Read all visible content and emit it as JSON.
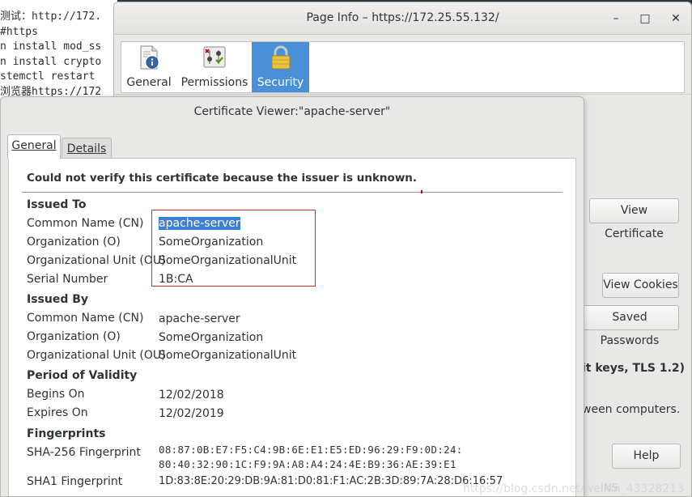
{
  "terminal": {
    "lines": [
      "测试：http://172.",
      "#https",
      "n install mod_ss",
      "n install crypto",
      "stemctl restart",
      "浏览器https://172"
    ]
  },
  "page_info": {
    "title": "Page Info – https://172.25.55.132/",
    "window_controls": {
      "minimize": "–",
      "maximize": "□",
      "close": "✕"
    },
    "tabs": [
      {
        "label": "General",
        "icon": "page-info-icon"
      },
      {
        "label": "Permissions",
        "icon": "permissions-icon"
      },
      {
        "label": "Security",
        "icon": "lock-icon",
        "selected": true
      }
    ],
    "view_certificate_label": "View Certificate",
    "view_cookies_label": "View Cookies",
    "saved_passwords_label": "Saved Passwords",
    "tls_text": "it keys, TLS 1.2)",
    "computers_text": "ween computers.",
    "help_label": "Help",
    "ins_label": "INS",
    "accent_color": "#4a90d9"
  },
  "cert_viewer": {
    "title": "Certificate Viewer:\"apache-server\"",
    "tabs": {
      "general": "General",
      "details": "Details"
    },
    "warning": "Could not verify this certificate because the issuer is unknown.",
    "issued_to": {
      "heading": "Issued To",
      "cn_label": "Common Name (CN)",
      "cn": "apache-server",
      "o_label": "Organization (O)",
      "o": "SomeOrganization",
      "ou_label": "Organizational Unit (OU)",
      "ou": "SomeOrganizationalUnit",
      "serial_label": "Serial Number",
      "serial": "1B:CA"
    },
    "issued_by": {
      "heading": "Issued By",
      "cn_label": "Common Name (CN)",
      "cn": "apache-server",
      "o_label": "Organization (O)",
      "o": "SomeOrganization",
      "ou_label": "Organizational Unit (OU)",
      "ou": "SomeOrganizationalUnit"
    },
    "validity": {
      "heading": "Period of Validity",
      "begins_label": "Begins On",
      "begins": "12/02/2018",
      "expires_label": "Expires On",
      "expires": "12/02/2019"
    },
    "fingerprints": {
      "heading": "Fingerprints",
      "sha256_label": "SHA-256 Fingerprint",
      "sha256_line1": "08:87:0B:E7:F5:C4:9B:6E:E1:E5:ED:96:29:F9:0D:24:",
      "sha256_line2": "80:40:32:90:1C:F9:9A:A8:A4:24:4E:B9:36:AE:39:E1",
      "sha1_label": "SHA1 Fingerprint",
      "sha1": "1D:83:8E:20:29:DB:9A:81:D0:81:F1:AC:2B:3D:89:7A:28:D6:16:57"
    },
    "highlight_color": "#d22a2a"
  },
  "watermark": "https://blog.csdn.net/weixin_43328213"
}
